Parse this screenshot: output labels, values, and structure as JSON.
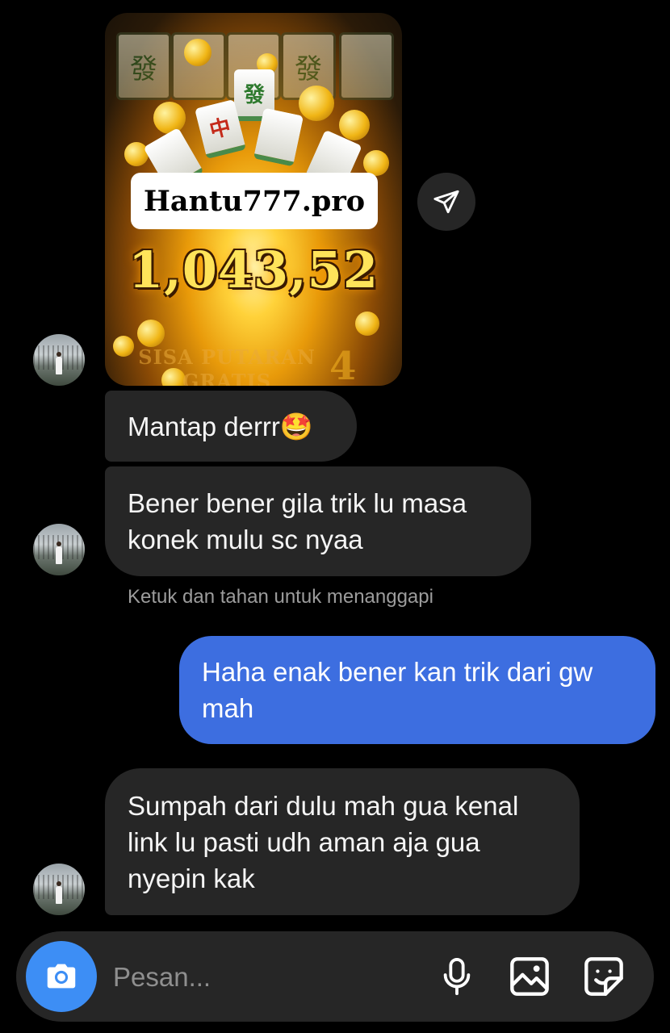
{
  "shared_image": {
    "label": "Hantu777.pro",
    "amount": "1,043,52",
    "caption": "SISA PUTARAN GRATIS",
    "counter": "4"
  },
  "messages": {
    "m1": {
      "line1": "Mantap derrr",
      "emoji": "🤩"
    },
    "m2": {
      "line1": "Bener bener gila trik lu masa",
      "line2": "konek mulu sc nyaa"
    },
    "hint": "Ketuk dan tahan untuk menanggapi",
    "m3": {
      "line1": "Haha enak bener kan trik dari gw",
      "line2": "mah"
    },
    "m4": {
      "line1": "Sumpah dari dulu mah gua kenal",
      "line2": "link lu pasti udh aman aja gua",
      "line3": "nyepin kak"
    }
  },
  "composer": {
    "placeholder": "Pesan...",
    "icons": [
      "camera-icon",
      "microphone-icon",
      "gallery-icon",
      "sticker-icon"
    ]
  },
  "colors": {
    "background": "#000000",
    "incoming_bubble": "#262626",
    "outgoing_bubble": "#3d6ee0",
    "camera_button": "#3d8ef5"
  }
}
